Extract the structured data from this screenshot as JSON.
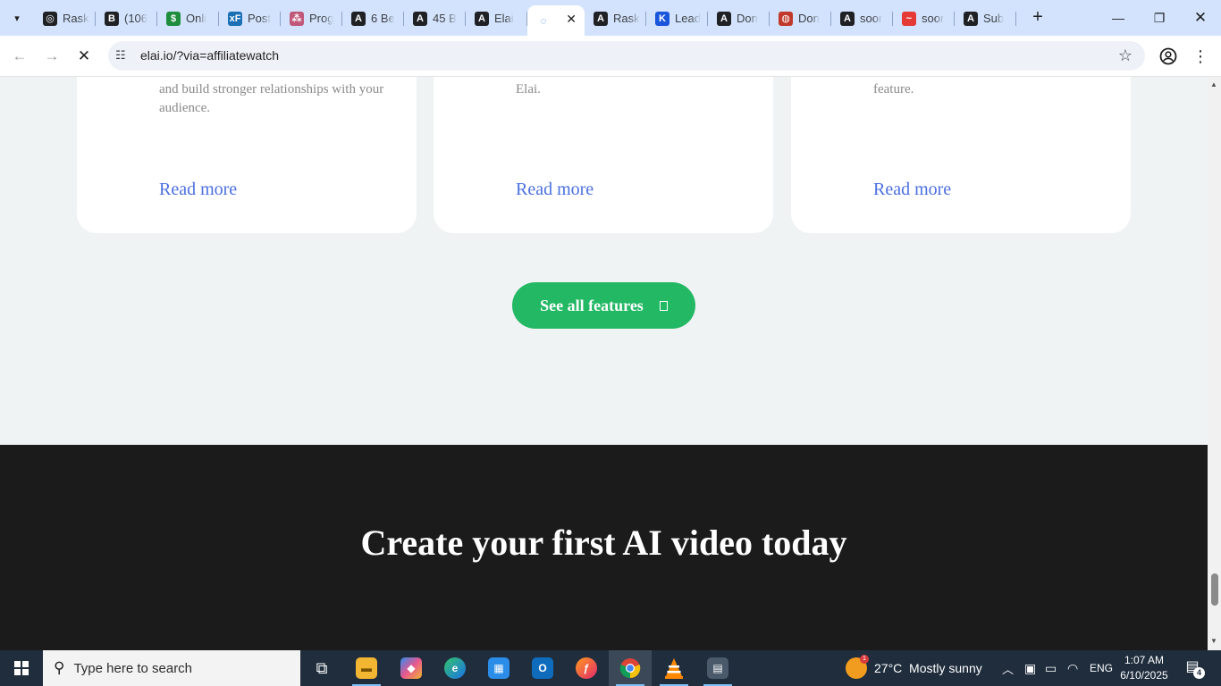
{
  "browser": {
    "tabs": [
      {
        "title": "Rask",
        "icon": "chatgpt-icon",
        "color": "#202124",
        "glyph": "◎"
      },
      {
        "title": "(106",
        "icon": "b-circle-icon",
        "color": "#202124",
        "glyph": "B"
      },
      {
        "title": "Onli",
        "icon": "dollar-icon",
        "color": "#1e8e3e",
        "glyph": "$"
      },
      {
        "title": "Post",
        "icon": "xf-icon",
        "color": "#1a6fb5",
        "glyph": "xF"
      },
      {
        "title": "Prog",
        "icon": "dots-icon",
        "color": "#c0587a",
        "glyph": "⁂"
      },
      {
        "title": "6 Be",
        "icon": "letter-a-icon",
        "color": "#202124",
        "glyph": "A"
      },
      {
        "title": "45 B",
        "icon": "letter-a-icon",
        "color": "#202124",
        "glyph": "A"
      },
      {
        "title": "Elai",
        "icon": "letter-a-icon",
        "color": "#202124",
        "glyph": "A"
      },
      {
        "title": "",
        "icon": "loading-spinner-icon",
        "color": "#1a73e8",
        "glyph": "◌",
        "active": true
      },
      {
        "title": "Rask",
        "icon": "letter-a-icon",
        "color": "#202124",
        "glyph": "A"
      },
      {
        "title": "Lead",
        "icon": "k-logo-icon",
        "color": "#1a56db",
        "glyph": "K"
      },
      {
        "title": "Don",
        "icon": "letter-a-icon",
        "color": "#202124",
        "glyph": "A"
      },
      {
        "title": "Don",
        "icon": "globe-icon",
        "color": "#c0392b",
        "glyph": "◍"
      },
      {
        "title": "soor",
        "icon": "letter-a-icon",
        "color": "#202124",
        "glyph": "A"
      },
      {
        "title": "soor",
        "icon": "wave-logo-icon",
        "color": "#e53935",
        "glyph": "~"
      },
      {
        "title": "Sub",
        "icon": "letter-a-icon",
        "color": "#202124",
        "glyph": "A"
      }
    ],
    "url": "elai.io/?via=affiliatewatch"
  },
  "page": {
    "cards": [
      {
        "text": "and build stronger relationships with your audience.",
        "link": "Read more"
      },
      {
        "text": "Elai.",
        "link": "Read more"
      },
      {
        "text": "feature.",
        "link": "Read more"
      }
    ],
    "cta_label": "See all features",
    "heading": "Create your first AI video today"
  },
  "taskbar": {
    "search_placeholder": "Type here to search",
    "weather": "27°C  Mostly sunny",
    "language": "ENG",
    "time": "1:07 AM",
    "date": "6/10/2025",
    "notifications": "4"
  },
  "colors": {
    "accent_green": "#22b864",
    "link_blue": "#4a6fe0",
    "dark_section": "#1b1b1b"
  }
}
